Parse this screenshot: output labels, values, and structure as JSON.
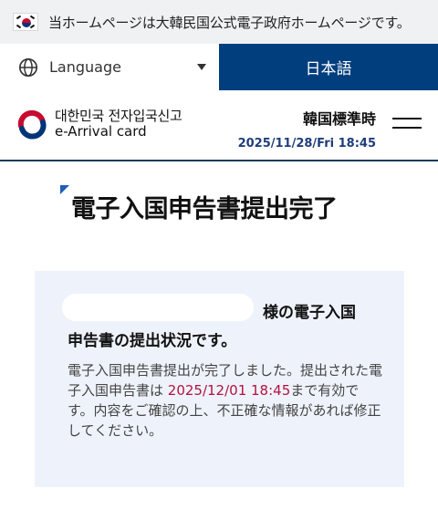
{
  "gov_banner": {
    "text": "当ホームページは大韓民国公式電子政府ホームページです。",
    "flag_icon": "korean-flag-icon"
  },
  "language_bar": {
    "select_label": "Language",
    "current_language": "日本語",
    "icons": {
      "globe": "globe-icon",
      "caret": "caret-down-icon"
    },
    "accent_color": "#003e7e"
  },
  "header": {
    "logo_korean": "대한민국 전자입국신고",
    "logo_english": "e-Arrival card",
    "time_title": "韓国標準時",
    "time_value": "2025/11/28/Fri 18:45",
    "menu_icon": "hamburger-menu-icon"
  },
  "main": {
    "title": "電子入国申告書提出完了"
  },
  "status": {
    "heading_line1": "様の電子入国",
    "heading_line2": "申告書の提出状況です。",
    "body_part1": "電子入国申告書提出が完了しました。提出された電子入国申告書は ",
    "highlight": "2025/12/01 18:45",
    "body_part2": "まで有効です。内容をご確認の上、不正確な情報があれば修正してください。",
    "highlight_color": "#b3123f"
  }
}
